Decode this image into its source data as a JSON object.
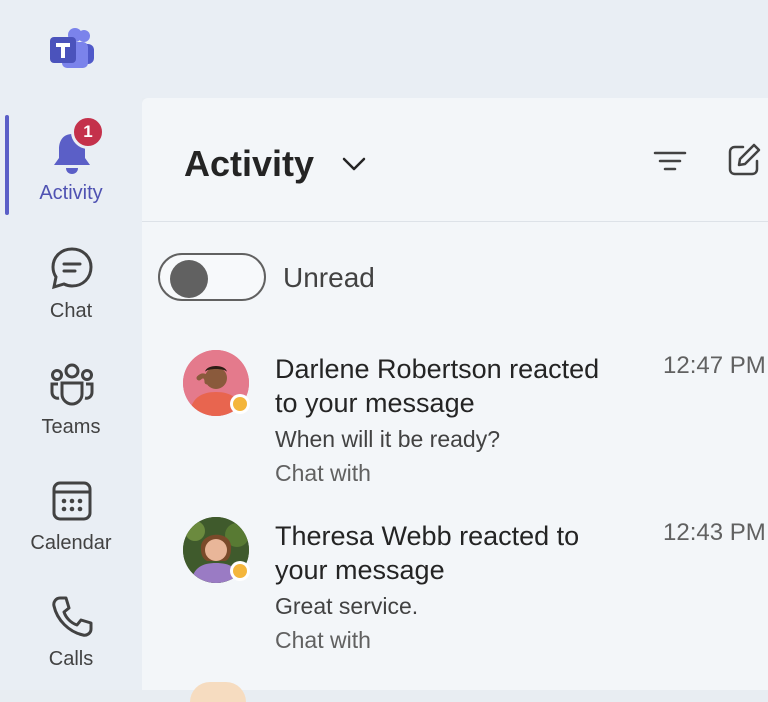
{
  "app": {
    "name": "Microsoft Teams"
  },
  "nav": {
    "activity": {
      "label": "Activity",
      "badge": "1"
    },
    "chat": {
      "label": "Chat"
    },
    "teams": {
      "label": "Teams"
    },
    "calendar": {
      "label": "Calendar"
    },
    "calls": {
      "label": "Calls"
    }
  },
  "header": {
    "title": "Activity"
  },
  "filter": {
    "unread_label": "Unread",
    "unread_on": false
  },
  "items": [
    {
      "title": "Darlene Robertson reacted to your message",
      "preview": "When will it be ready?",
      "subtitle": "Chat with",
      "time": "12:47 PM"
    },
    {
      "title": "Theresa Webb reacted to your message",
      "preview": "Great service.",
      "subtitle": "Chat with",
      "time": "12:43 PM"
    }
  ],
  "colors": {
    "accent": "#5b5fc7",
    "badge": "#c4314b"
  }
}
